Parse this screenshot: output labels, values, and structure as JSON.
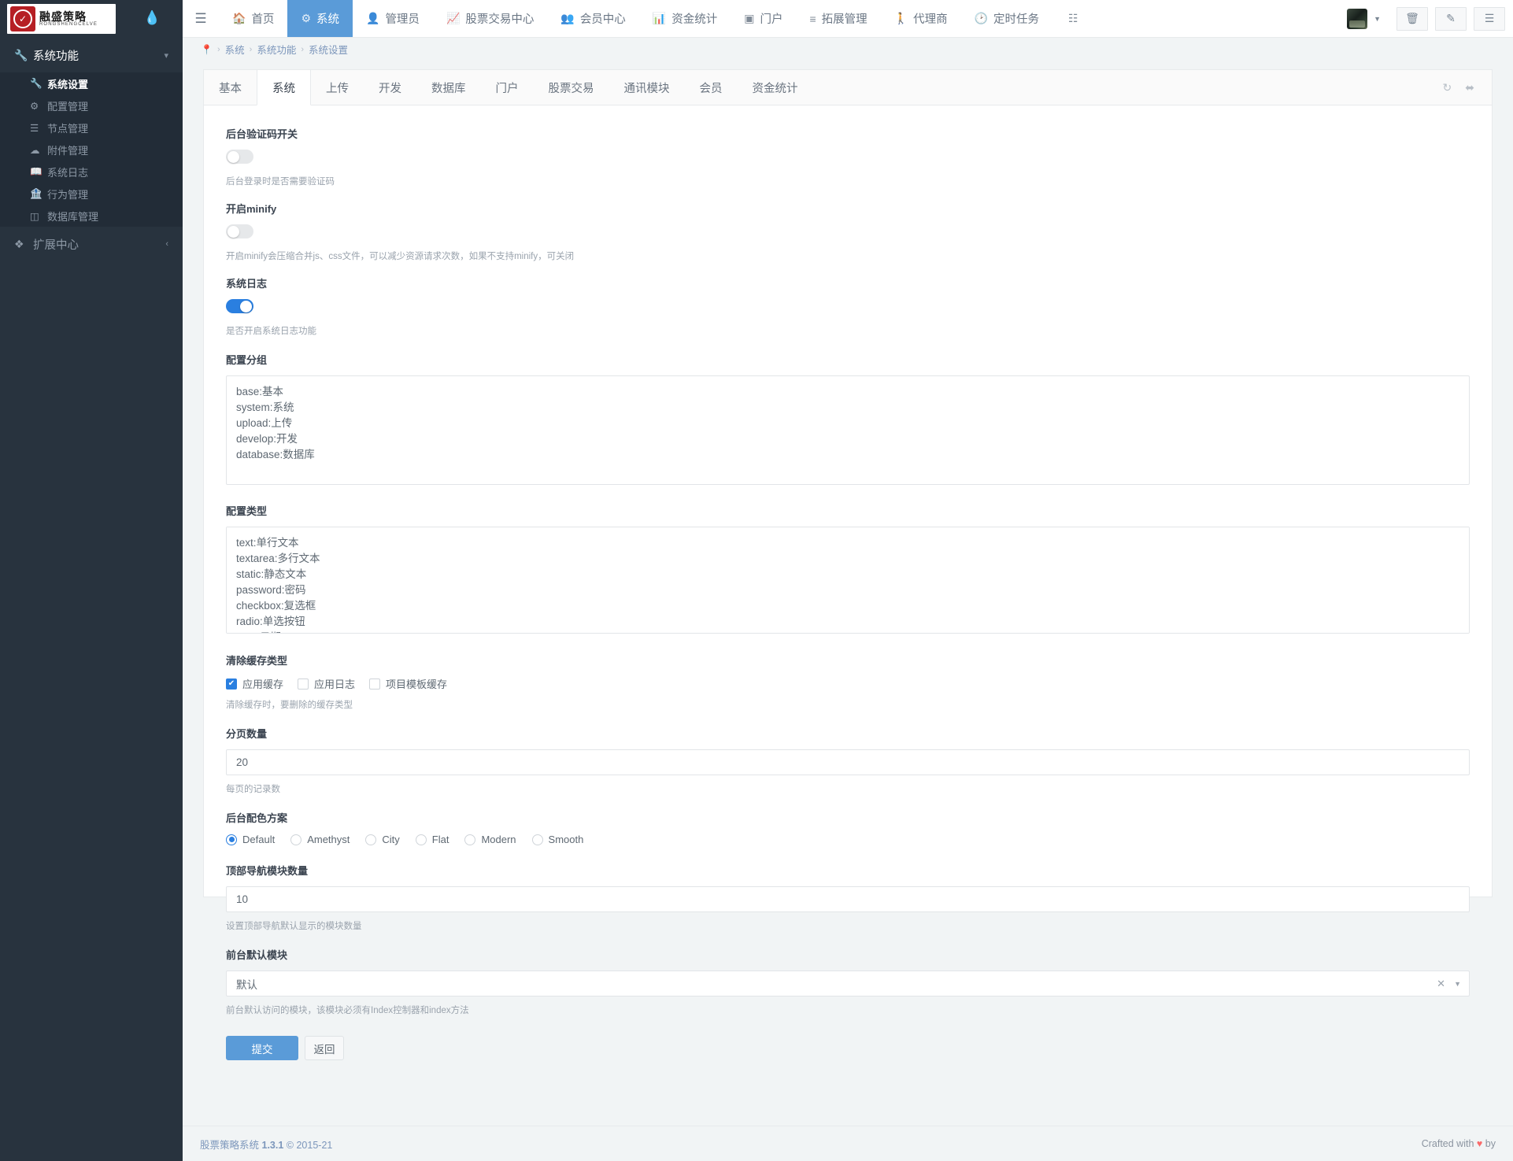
{
  "brand": {
    "logo_cn": "融盛策略",
    "logo_en": "RONGSHENGCELVE",
    "logo_mark": "chart-circle-icon"
  },
  "sidebar": {
    "group": {
      "label": "系统功能",
      "icon": "wrench-icon",
      "chevron": "chevron-down-icon"
    },
    "items": [
      {
        "label": "系统设置",
        "icon": "wrench-icon",
        "active": true
      },
      {
        "label": "配置管理",
        "icon": "gears-icon",
        "active": false
      },
      {
        "label": "节点管理",
        "icon": "list-icon",
        "active": false
      },
      {
        "label": "附件管理",
        "icon": "cloud-upload-icon",
        "active": false
      },
      {
        "label": "系统日志",
        "icon": "book-icon",
        "active": false
      },
      {
        "label": "行为管理",
        "icon": "bank-icon",
        "active": false
      },
      {
        "label": "数据库管理",
        "icon": "database-icon",
        "active": false
      }
    ],
    "group2": {
      "label": "扩展中心",
      "icon": "cube-icon",
      "chevron": "chevron-left-icon"
    }
  },
  "topbar": {
    "hamburger": "hamburger-icon",
    "nav": [
      {
        "label": "首页",
        "icon": "home-icon",
        "active": false
      },
      {
        "label": "系统",
        "icon": "gear-icon",
        "active": true
      },
      {
        "label": "管理员",
        "icon": "user-icon",
        "active": false
      },
      {
        "label": "股票交易中心",
        "icon": "line-chart-icon",
        "active": false
      },
      {
        "label": "会员中心",
        "icon": "users-icon",
        "active": false
      },
      {
        "label": "资金统计",
        "icon": "bar-chart-icon",
        "active": false
      },
      {
        "label": "门户",
        "icon": "window-icon",
        "active": false
      },
      {
        "label": "拓展管理",
        "icon": "list-ul-icon",
        "active": false
      },
      {
        "label": "代理商",
        "icon": "person-icon",
        "active": false
      },
      {
        "label": "定时任务",
        "icon": "clock-icon",
        "active": false
      },
      {
        "label": "",
        "icon": "grid-icon",
        "active": false
      }
    ],
    "right": {
      "avatar": "avatar",
      "caret": "caret-down-icon",
      "buttons": [
        {
          "icon": "trash-icon",
          "name": "clear-cache-button"
        },
        {
          "icon": "pencil-square-icon",
          "name": "note-button"
        },
        {
          "icon": "bars-align-icon",
          "name": "panel-toggle-button"
        }
      ]
    }
  },
  "breadcrumb": {
    "pin": "location-pin-icon",
    "items": [
      "系统",
      "系统功能",
      "系统设置"
    ],
    "separator": "›"
  },
  "tabs": {
    "items": [
      {
        "label": "基本",
        "active": false
      },
      {
        "label": "系统",
        "active": true
      },
      {
        "label": "上传",
        "active": false
      },
      {
        "label": "开发",
        "active": false
      },
      {
        "label": "数据库",
        "active": false
      },
      {
        "label": "门户",
        "active": false
      },
      {
        "label": "股票交易",
        "active": false
      },
      {
        "label": "通讯模块",
        "active": false
      },
      {
        "label": "会员",
        "active": false
      },
      {
        "label": "资金统计",
        "active": false
      }
    ],
    "tools": [
      {
        "icon": "refresh-icon",
        "name": "refresh-button"
      },
      {
        "icon": "expand-icon",
        "name": "fullscreen-button"
      }
    ]
  },
  "form": {
    "captcha": {
      "label": "后台验证码开关",
      "help": "后台登录时是否需要验证码",
      "value": false
    },
    "minify": {
      "label": "开启minify",
      "help": "开启minify会压缩合并js、css文件，可以减少资源请求次数，如果不支持minify，可关闭",
      "value": false
    },
    "syslog": {
      "label": "系统日志",
      "help": "是否开启系统日志功能",
      "value": true
    },
    "config_group": {
      "label": "配置分组",
      "value": "base:基本\nsystem:系统\nupload:上传\ndevelop:开发\ndatabase:数据库"
    },
    "config_type": {
      "label": "配置类型",
      "value": "text:单行文本\ntextarea:多行文本\nstatic:静态文本\npassword:密码\ncheckbox:复选框\nradio:单选按钮\ndate:日期\ndatetime:日期+时间"
    },
    "cache_type": {
      "label": "清除缓存类型",
      "help": "清除缓存时，要删除的缓存类型",
      "options": [
        {
          "label": "应用缓存",
          "checked": true
        },
        {
          "label": "应用日志",
          "checked": false
        },
        {
          "label": "项目模板缓存",
          "checked": false
        }
      ]
    },
    "page_size": {
      "label": "分页数量",
      "value": "20",
      "help": "每页的记录数"
    },
    "color_scheme": {
      "label": "后台配色方案",
      "options": [
        {
          "label": "Default",
          "checked": true
        },
        {
          "label": "Amethyst",
          "checked": false
        },
        {
          "label": "City",
          "checked": false
        },
        {
          "label": "Flat",
          "checked": false
        },
        {
          "label": "Modern",
          "checked": false
        },
        {
          "label": "Smooth",
          "checked": false
        }
      ]
    },
    "topnav_count": {
      "label": "顶部导航模块数量",
      "value": "10",
      "help": "设置顶部导航默认显示的模块数量"
    },
    "default_module": {
      "label": "前台默认模块",
      "value": "默认",
      "help": "前台默认访问的模块，该模块必须有Index控制器和index方法",
      "clear_icon": "close-icon",
      "dropdown_icon": "caret-down-icon"
    },
    "submit_label": "提交",
    "back_label": "返回"
  },
  "footer": {
    "left_name": "股票策略系统",
    "left_version": "1.3.1",
    "left_copy": "© 2015-21",
    "right_prefix": "Crafted with",
    "right_heart": "♥",
    "right_suffix": "by"
  },
  "colors": {
    "accent": "#5a9bd8",
    "sidebar": "#28333e",
    "sidebar_sub": "#222c37",
    "switch_on": "#2a7fe0",
    "brand_red": "#b61f24",
    "heart": "#fa6a6a"
  }
}
